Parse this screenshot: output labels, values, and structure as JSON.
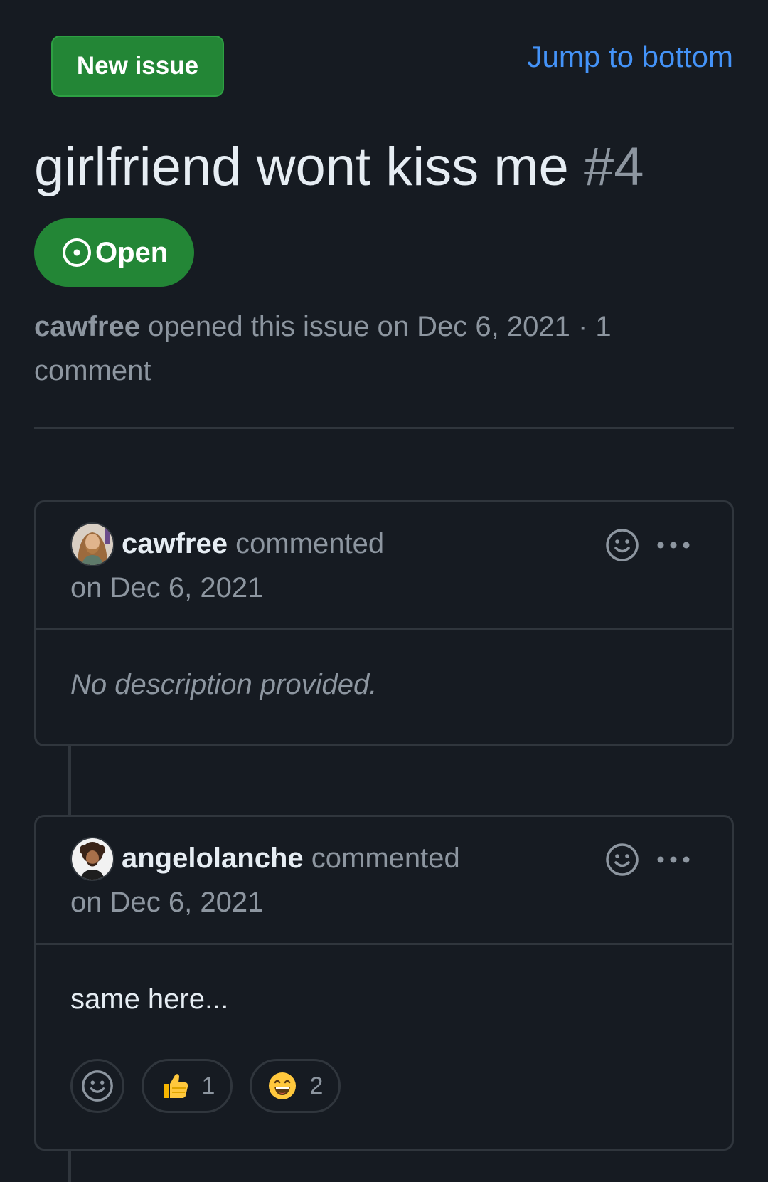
{
  "header": {
    "new_issue_label": "New issue",
    "jump_label": "Jump to bottom"
  },
  "issue": {
    "title": "girlfriend wont kiss me",
    "number": "#4",
    "state": "Open",
    "author": "cawfree",
    "meta_text": " opened this issue on Dec 6, 2021 · 1 comment"
  },
  "comments": [
    {
      "author": "cawfree",
      "action": "commented",
      "date": "on Dec 6, 2021",
      "body": "No description provided.",
      "avatar_icon": "avatar-bearded-man"
    },
    {
      "author": "angelolanche",
      "action": "commented",
      "date": "on Dec 6, 2021",
      "body": "same here...",
      "avatar_icon": "avatar-curly-hair-man",
      "reactions": [
        {
          "emoji": "👍",
          "count": "1"
        },
        {
          "emoji": "😄",
          "count": "2"
        }
      ]
    }
  ],
  "colors": {
    "background": "#161b22",
    "border": "#30363d",
    "accent_green": "#238636",
    "link_blue": "#4493f8",
    "muted_text": "#8d96a0"
  }
}
